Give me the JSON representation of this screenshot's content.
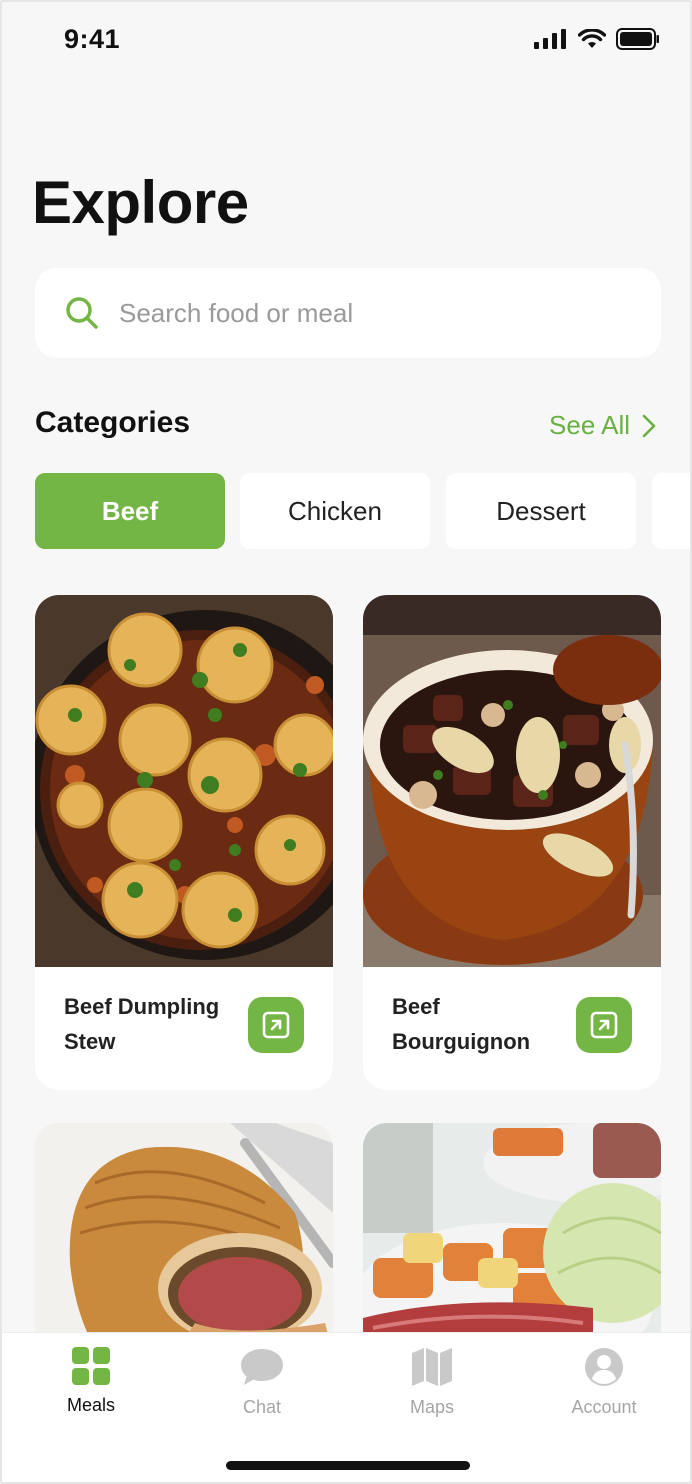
{
  "status_bar": {
    "time": "9:41"
  },
  "page": {
    "title": "Explore"
  },
  "search": {
    "placeholder": "Search food or meal",
    "value": ""
  },
  "categories": {
    "title": "Categories",
    "see_all": "See All",
    "items": [
      {
        "label": "Beef",
        "selected": true
      },
      {
        "label": "Chicken",
        "selected": false
      },
      {
        "label": "Dessert",
        "selected": false
      },
      {
        "label": "",
        "selected": false
      }
    ]
  },
  "meals": [
    {
      "name": "Beef Dumpling Stew",
      "image": "beef-dumpling-stew-photo"
    },
    {
      "name": "Beef Bourguignon",
      "image": "beef-bourguignon-photo"
    },
    {
      "name": "",
      "image": "beef-wellington-photo"
    },
    {
      "name": "",
      "image": "corned-beef-cabbage-photo"
    }
  ],
  "tabbar": {
    "items": [
      {
        "label": "Meals",
        "icon": "grid-icon",
        "active": true
      },
      {
        "label": "Chat",
        "icon": "chat-bubble-icon",
        "active": false
      },
      {
        "label": "Maps",
        "icon": "map-icon",
        "active": false
      },
      {
        "label": "Account",
        "icon": "user-icon",
        "active": false
      }
    ]
  },
  "colors": {
    "accent": "#74b645",
    "background": "#f7f7f7",
    "inactive_tab": "#a6a6a6"
  }
}
